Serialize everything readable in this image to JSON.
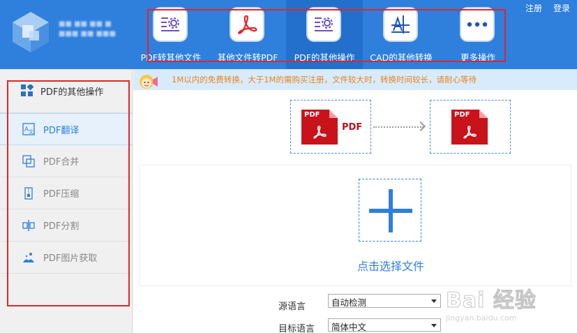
{
  "header": {
    "auth": {
      "register": "注册",
      "login": "登录"
    },
    "nav": [
      {
        "label": "PDF转其他文件",
        "icon": "settings-doc-icon",
        "active": false
      },
      {
        "label": "其他文件转PDF",
        "icon": "acrobat-icon",
        "active": false
      },
      {
        "label": "PDF的其他操作",
        "icon": "settings-doc-icon",
        "active": true
      },
      {
        "label": "CAD的其他转换",
        "icon": "cad-icon",
        "active": false
      },
      {
        "label": "更多操作",
        "icon": "more-dots-icon",
        "active": false
      }
    ]
  },
  "sidebar": {
    "title": "PDF的其他操作",
    "items": [
      {
        "label": "PDF翻译",
        "icon": "translate-icon",
        "active": true
      },
      {
        "label": "PDF合并",
        "icon": "merge-icon",
        "active": false
      },
      {
        "label": "PDF压缩",
        "icon": "compress-icon",
        "active": false
      },
      {
        "label": "PDF分割",
        "icon": "split-icon",
        "active": false
      },
      {
        "label": "PDF图片获取",
        "icon": "image-extract-icon",
        "active": false
      }
    ]
  },
  "notice": {
    "text": "1M以内的免费转换，大于1M的需购买注册，文件较大时，转换时间较长，请耐心等待"
  },
  "conversion": {
    "source_badge": "PDF",
    "source_word": "PDF",
    "target_badge": "PDF"
  },
  "upload": {
    "label": "点击选择文件"
  },
  "form": {
    "source_lang_label": "源语言",
    "source_lang_value": "自动检测",
    "target_lang_label": "目标语言",
    "target_lang_value": "简体中文"
  },
  "watermark": {
    "main": "Bai 经验",
    "sub": "jingyan.baidu.com"
  },
  "colors": {
    "brand": "#2f7fdc",
    "highlight_frame": "#e0262b",
    "notice": "#e8841e",
    "pdf_red": "#c8131b"
  }
}
